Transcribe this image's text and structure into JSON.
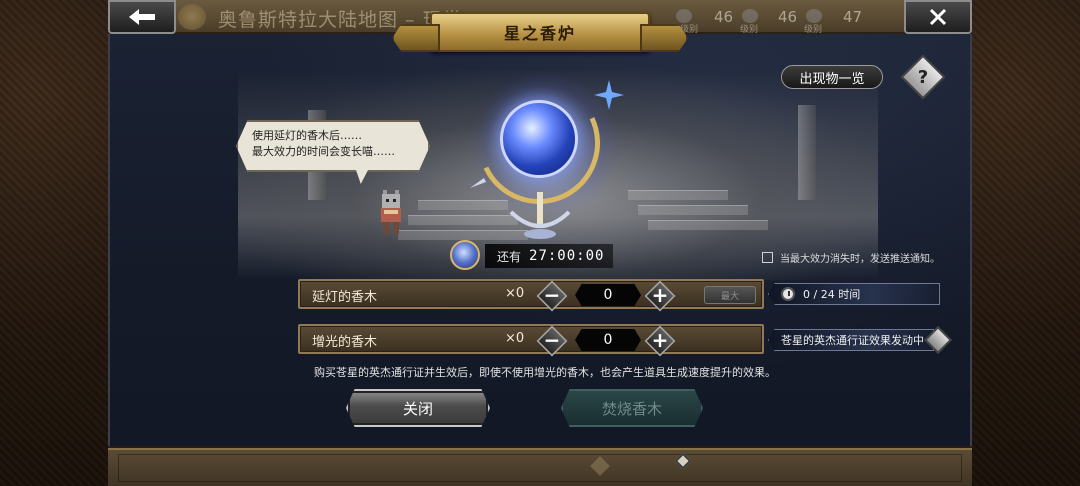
{
  "map": {
    "title": "奥鲁斯特拉大陆地图 – 现世",
    "levels": [
      {
        "value": "46",
        "sub": "级别"
      },
      {
        "value": "46",
        "sub": "级别"
      },
      {
        "value": "47",
        "sub": ""
      }
    ]
  },
  "nav": {
    "back_icon": "arrow-left-icon",
    "close_icon": "x-close-icon"
  },
  "dialog": {
    "title": "星之香炉",
    "appearance_list_label": "出现物一览",
    "help_label": "?",
    "speech": {
      "line1": "使用延灯的香木后……",
      "line2": "最大效力的时间会变长喵……"
    },
    "timer": {
      "label": "还有",
      "value": "27:00:00"
    },
    "notify": {
      "checked": false,
      "label": "当最大效力消失时，发送推送通知。"
    },
    "items": [
      {
        "name": "延灯的香木",
        "count": "×0",
        "quantity": "0",
        "max_label": "最大",
        "info": "0 / 24 时间"
      },
      {
        "name": "增光的香木",
        "count": "×0",
        "quantity": "0",
        "info": "苍星的英杰通行证效果发动中"
      }
    ],
    "footnote": "购买苍星的英杰通行证并生效后，即使不使用增光的香木，也会产生道具生成速度提升的效果。",
    "close_button": "关闭",
    "burn_button": "焚烧香木"
  },
  "colors": {
    "panel_bg": "#141a28",
    "wood_row": "#4a3d2b",
    "gold_accent": "#d8b66a",
    "burn_disabled": "#2b4648"
  }
}
